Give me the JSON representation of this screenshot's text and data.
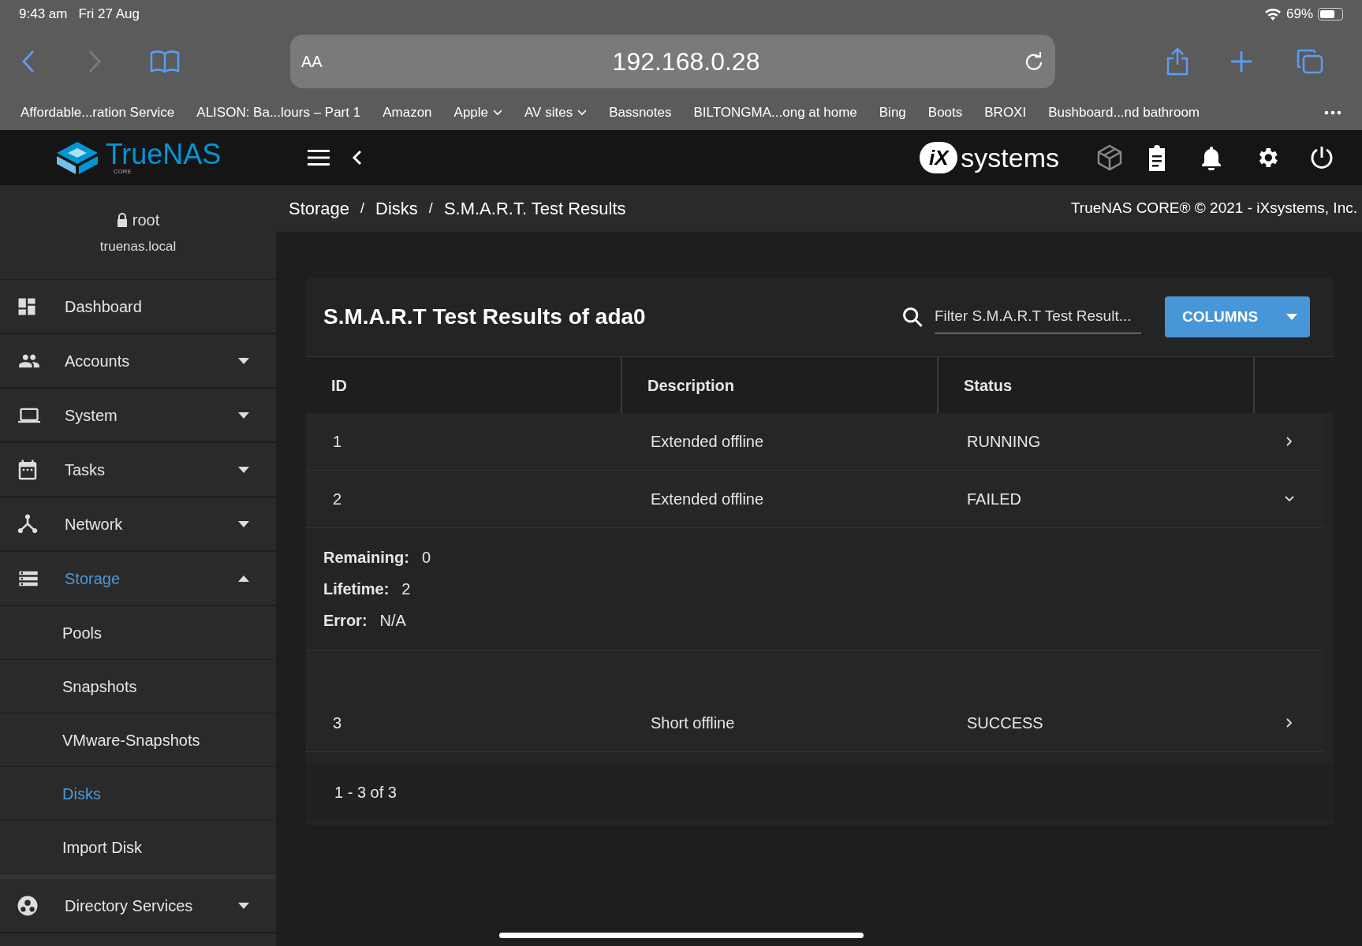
{
  "status_bar": {
    "time": "9:43 am",
    "date": "Fri 27 Aug",
    "battery": "69%"
  },
  "browser": {
    "text_size": "AA",
    "url": "192.168.0.28",
    "bookmarks": [
      {
        "label": "Affordable...ration Service",
        "kind": "link"
      },
      {
        "label": "ALISON: Ba...lours – Part 1",
        "kind": "link"
      },
      {
        "label": "Amazon",
        "kind": "link"
      },
      {
        "label": "Apple",
        "kind": "folder"
      },
      {
        "label": "AV sites",
        "kind": "folder"
      },
      {
        "label": "Bassnotes",
        "kind": "link"
      },
      {
        "label": "BILTONGMA...ong at home",
        "kind": "link"
      },
      {
        "label": "Bing",
        "kind": "link"
      },
      {
        "label": "Boots",
        "kind": "link"
      },
      {
        "label": "BROXI",
        "kind": "link"
      },
      {
        "label": "Bushboard...nd bathroom",
        "kind": "link"
      }
    ]
  },
  "app_header": {
    "logo": "TrueNAS",
    "edition": "CORE",
    "vendor_mark": "iX",
    "vendor_name": "systems"
  },
  "breadcrumb": {
    "separator": "/",
    "items": [
      "Storage",
      "Disks",
      "S.M.A.R.T. Test Results"
    ]
  },
  "copyright": "TrueNAS CORE® © 2021 - iXsystems, Inc.",
  "user": {
    "name": "root",
    "host": "truenas.local"
  },
  "sidebar": {
    "items": [
      {
        "label": "Dashboard",
        "kind": "link",
        "selected": false
      },
      {
        "label": "Accounts",
        "kind": "menu",
        "expanded": false,
        "selected": false
      },
      {
        "label": "System",
        "kind": "menu",
        "expanded": false,
        "selected": false
      },
      {
        "label": "Tasks",
        "kind": "menu",
        "expanded": false,
        "selected": false
      },
      {
        "label": "Network",
        "kind": "menu",
        "expanded": false,
        "selected": false
      },
      {
        "label": "Storage",
        "kind": "menu",
        "expanded": true,
        "selected": true,
        "children": [
          {
            "label": "Pools",
            "selected": false
          },
          {
            "label": "Snapshots",
            "selected": false
          },
          {
            "label": "VMware-Snapshots",
            "selected": false
          },
          {
            "label": "Disks",
            "selected": true
          },
          {
            "label": "Import Disk",
            "selected": false
          }
        ]
      },
      {
        "label": "Directory Services",
        "kind": "menu",
        "expanded": false,
        "selected": false
      }
    ]
  },
  "card": {
    "title": "S.M.A.R.T Test Results of ada0",
    "filter": {
      "placeholder": "Filter S.M.A.R.T Test Result..."
    },
    "columns_button": "COLUMNS",
    "table": {
      "columns": [
        "ID",
        "Description",
        "Status"
      ],
      "rows": [
        {
          "id": "1",
          "description": "Extended offline",
          "status": "RUNNING",
          "expanded": false
        },
        {
          "id": "2",
          "description": "Extended offline",
          "status": "FAILED",
          "expanded": true,
          "details": [
            {
              "label": "Remaining:",
              "value": "0"
            },
            {
              "label": "Lifetime:",
              "value": "2"
            },
            {
              "label": "Error:",
              "value": "N/A"
            }
          ]
        },
        {
          "id": "3",
          "description": "Short offline",
          "status": "SUCCESS",
          "expanded": false
        }
      ]
    },
    "pagination": "1 - 3 of 3"
  }
}
